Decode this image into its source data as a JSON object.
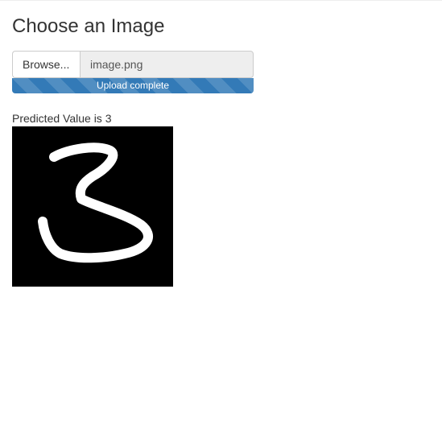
{
  "heading": "Choose an Image",
  "file_input": {
    "browse_label": "Browse...",
    "file_name": "image.png"
  },
  "upload": {
    "status_text": "Upload complete",
    "progress_percent": 100
  },
  "result": {
    "prediction_text": "Predicted Value is 3"
  }
}
